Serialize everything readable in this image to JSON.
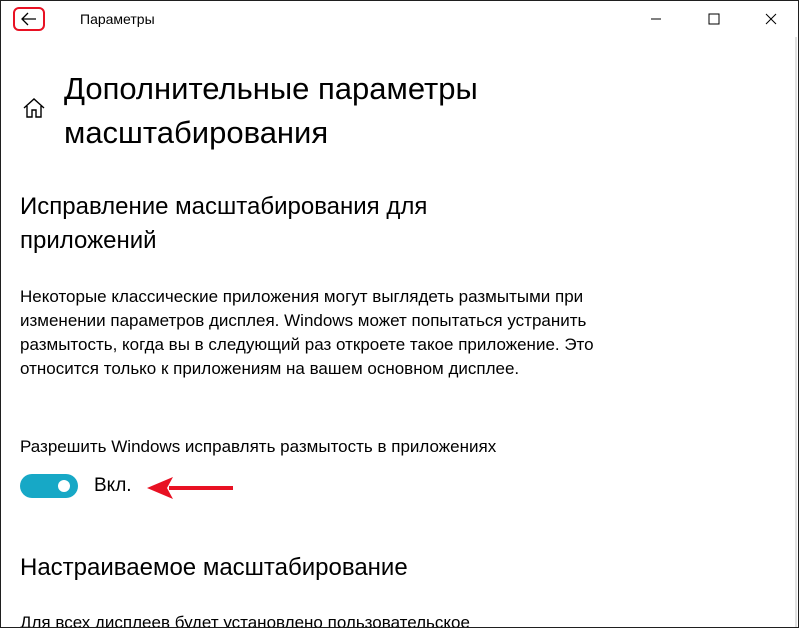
{
  "window": {
    "title": "Параметры"
  },
  "page": {
    "title": "Дополнительные параметры масштабирования"
  },
  "section_fix": {
    "title": "Исправление масштабирования для приложений",
    "description": "Некоторые классические приложения могут выглядеть размытыми при изменении параметров дисплея. Windows может попытаться устранить размытость, когда вы в следующий раз откроете такое приложение. Это относится только к приложениям на вашем основном дисплее.",
    "toggle_label": "Разрешить Windows исправлять размытость в приложениях",
    "toggle_state": "Вкл.",
    "toggle_on": true
  },
  "section_custom": {
    "title": "Настраиваемое масштабирование",
    "description": "Для всех дисплеев будет установлено пользовательское"
  },
  "colors": {
    "accent": "#17a8c6",
    "highlight": "#e81123"
  },
  "icons": {
    "back": "back-arrow-icon",
    "home": "home-icon",
    "minimize": "minimize-icon",
    "maximize": "maximize-icon",
    "close": "close-icon",
    "annotation": "red-arrow-icon"
  }
}
